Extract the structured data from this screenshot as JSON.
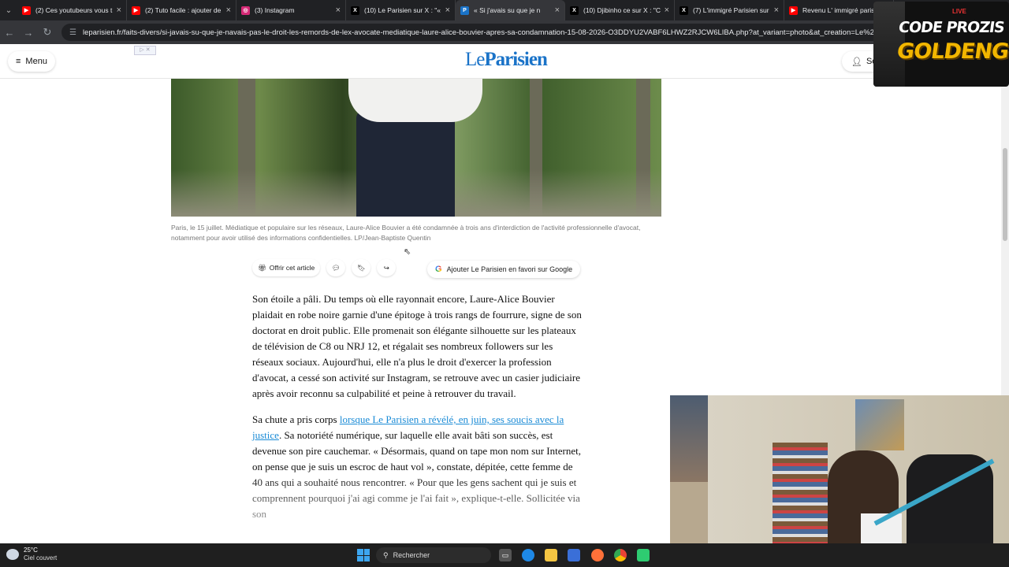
{
  "browser": {
    "tabs": [
      {
        "title": "(2) Ces youtubeurs vous t",
        "favicon": "youtube-icon",
        "color": "#ff0000"
      },
      {
        "title": "(2) Tuto facile : ajouter de",
        "favicon": "youtube-icon",
        "color": "#ff0000"
      },
      {
        "title": "(3) Instagram",
        "favicon": "instagram-icon",
        "color": "#d62976"
      },
      {
        "title": "(10) Le Parisien sur X : \"«",
        "favicon": "x-icon",
        "color": "#000000"
      },
      {
        "title": "« Si j'avais su que je n",
        "favicon": "le-parisien-icon",
        "color": "#1a73c8",
        "active": true
      },
      {
        "title": "(10) Djibinho ce sur X : \"C",
        "favicon": "x-icon",
        "color": "#000000"
      },
      {
        "title": "(7) L'immigré Parisien sur",
        "favicon": "x-icon",
        "color": "#000000"
      },
      {
        "title": "Revenu L' immigré parisie",
        "favicon": "youtube-icon",
        "color": "#ff0000"
      }
    ],
    "url": "leparisien.fr/faits-divers/si-javais-su-que-je-navais-pas-le-droit-les-remords-de-lex-avocate-mediatique-laure-alice-bouvier-apres-sa-condamnation-15-08-2026-O3DDYU2VABF6LHWZ2RJCW6LIBA.php?at_variant=photo&at_creation=Le%20Parisien"
  },
  "header": {
    "menu_label": "Menu",
    "logo_prefix": "Le",
    "logo_main": "Parisien",
    "signin_label": "Se",
    "brand_color": "#1a73c8"
  },
  "article": {
    "caption": "Paris, le 15 juillet. Médiatique et populaire sur les réseaux, Laure-Alice Bouvier a été condamnée à trois ans d'interdiction de l'activité professionnelle d'avocat, notamment pour avoir utilisé des informations confidentielles. LP/Jean-Baptiste Quentin",
    "share": {
      "offer_label": "Offrir cet article",
      "google_label": "Ajouter Le Parisien en favori sur Google"
    },
    "p1": "Son étoile a pâli. Du temps où elle rayonnait encore, Laure-Alice Bouvier plaidait en robe noire garnie d'une épitoge à trois rangs de fourrure, signe de son doctorat en droit public. Elle promenait son élégante silhouette sur les plateaux de télévision de C8 ou NRJ 12, et régalait ses nombreux followers sur les réseaux sociaux. Aujourd'hui, elle n'a plus le droit d'exercer la profession d'avocat, a cessé son activité sur Instagram, se retrouve avec un casier judiciaire après avoir reconnu sa culpabilité et peine à retrouver du travail.",
    "p2_start": "Sa chute a pris corps ",
    "p2_link": "lorsque Le Parisien a révélé, en juin, ses soucis avec la justice",
    "p2_end": ". Sa notoriété numérique, sur laquelle elle avait bâti son succès, est devenue son pire cauchemar. « Désormais, quand on tape mon nom sur Internet, on pense que je suis un escroc de haut vol », constate, dépitée, cette femme de 40 ans qui a souhaité nous rencontrer. « Pour que les gens sachent qui je suis et comprennent pourquoi j'ai agi comme je l'ai fait », explique-t-elle. Sollicitée via son"
  },
  "overlay": {
    "badge": "LIVE",
    "line1": "CODE PROZIS",
    "line2": "GOLDENG",
    "accent": "#f2b600"
  },
  "taskbar": {
    "temperature": "25°C",
    "weather": "Ciel couvert",
    "search_label": "Rechercher"
  }
}
